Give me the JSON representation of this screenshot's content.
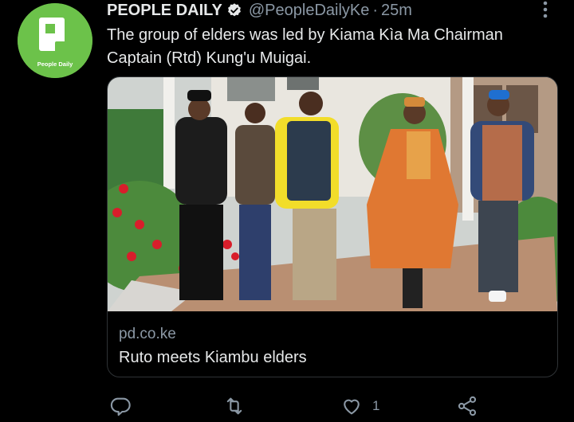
{
  "account": {
    "logo_text": "PD",
    "logo_caption": "People Daily",
    "display_name": "PEOPLE DAILY",
    "handle": "@PeopleDailyKe",
    "separator": "·",
    "time": "25m"
  },
  "tweet": {
    "text": "The group of elders was led by Kiama Kìa Ma Chairman Captain (Rtd) Kung'u Muigai."
  },
  "link_card": {
    "domain": "pd.co.ke",
    "title": "Ruto meets Kiambu elders",
    "image_icon": "photo-of-men-walking"
  },
  "actions": {
    "reply_icon": "reply-icon",
    "retweet_icon": "retweet-icon",
    "like_icon": "like-icon",
    "like_count": "1",
    "share_icon": "share-icon"
  },
  "colors": {
    "background": "#000000",
    "text": "#e7e9ea",
    "secondary": "#8b98a5",
    "logo_green": "#6cc24a",
    "verified": "#1d9bf0"
  }
}
